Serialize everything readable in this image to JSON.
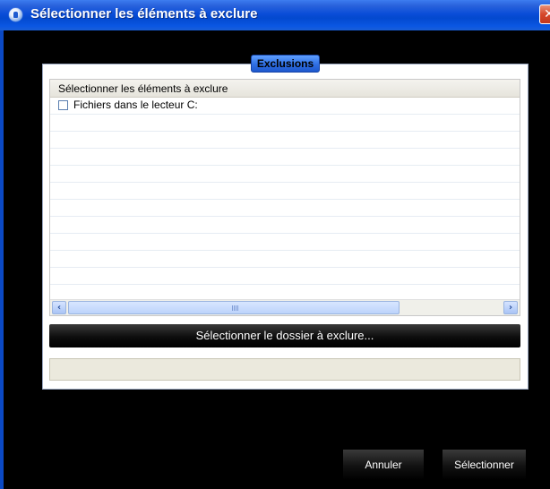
{
  "window": {
    "title": "Sélectionner les éléments à exclure",
    "close_glyph": "✕",
    "icon": "app-logo-icon"
  },
  "group": {
    "tab_label": "Exclusions"
  },
  "list": {
    "header": "Sélectionner les éléments à exclure",
    "items": [
      {
        "label": "Fichiers dans le lecteur C:",
        "checked": false
      }
    ]
  },
  "scrollbar": {
    "left_glyph": "‹",
    "right_glyph": "›"
  },
  "buttons": {
    "select_folder": "Sélectionner le dossier à exclure...",
    "cancel": "Annuler",
    "select": "Sélectionner"
  },
  "path_field": {
    "value": ""
  },
  "colors": {
    "titlebar": "#0a4dd8",
    "tab": "#2f6fe4",
    "background": "#000000"
  }
}
